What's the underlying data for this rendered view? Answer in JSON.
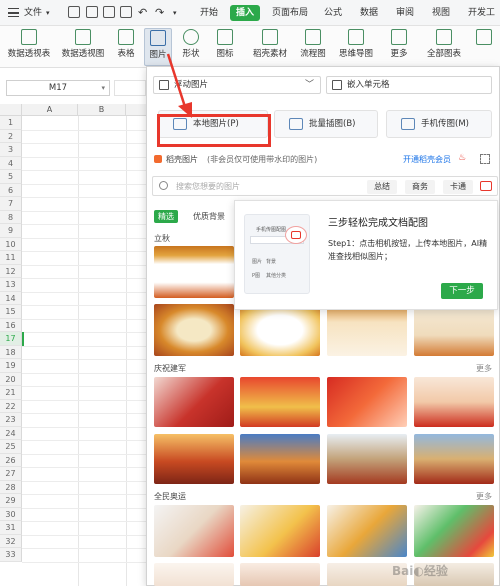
{
  "menu": {
    "file": "文件",
    "tabs": [
      "开始",
      "插入",
      "页面布局",
      "公式",
      "数据",
      "审阅",
      "视图",
      "开发工"
    ],
    "active_tab": "插入"
  },
  "ribbon": {
    "buttons": [
      "数据透视表",
      "数据透视图",
      "表格",
      "图片",
      "形状",
      "图标",
      "稻壳素材",
      "流程图",
      "思维导图",
      "更多",
      "全部图表"
    ]
  },
  "namebox": {
    "value": "M17"
  },
  "sheet": {
    "columns": [
      "A",
      "B"
    ],
    "rows": [
      "1",
      "2",
      "3",
      "4",
      "5",
      "6",
      "7",
      "8",
      "9",
      "10",
      "11",
      "12",
      "13",
      "14",
      "15",
      "16",
      "17",
      "18",
      "19",
      "20",
      "21",
      "22",
      "23",
      "24",
      "25",
      "26",
      "27",
      "28",
      "29",
      "30",
      "31",
      "32",
      "33"
    ],
    "selected_row": "17"
  },
  "panel": {
    "float_image": "浮动图片",
    "embed_cell": "嵌入单元格",
    "local_image": "本地图片(P)",
    "batch_image": "批量插图(B)",
    "phone_image": "手机传图(M)",
    "daoke_title": "稻壳图片",
    "daoke_note": "(非会员仅可使用带水印的图片)",
    "vip_link": "开通稻壳会员",
    "search_placeholder": "搜索您想要的图片",
    "search_tags": [
      "总结",
      "商务",
      "卡通"
    ],
    "filter_tabs": [
      "精选",
      "优质背景"
    ],
    "sections": [
      "立秋",
      "庆祝建军",
      "全民奥运"
    ],
    "more_label": "更多"
  },
  "popup": {
    "title": "三步轻松完成文档配图",
    "step_text": "Step1：点击相机按钮，上传本地图片，AI精准查找相似图片；",
    "next_button": "下一步",
    "mock_title": "手机传图配图",
    "mock_labels": [
      "P图",
      "其他分类"
    ],
    "mock_mid": [
      "图片",
      "背景"
    ]
  },
  "colors": {
    "accent": "#2ca94a",
    "highlight": "#e8372c",
    "link": "#1a73e8"
  }
}
